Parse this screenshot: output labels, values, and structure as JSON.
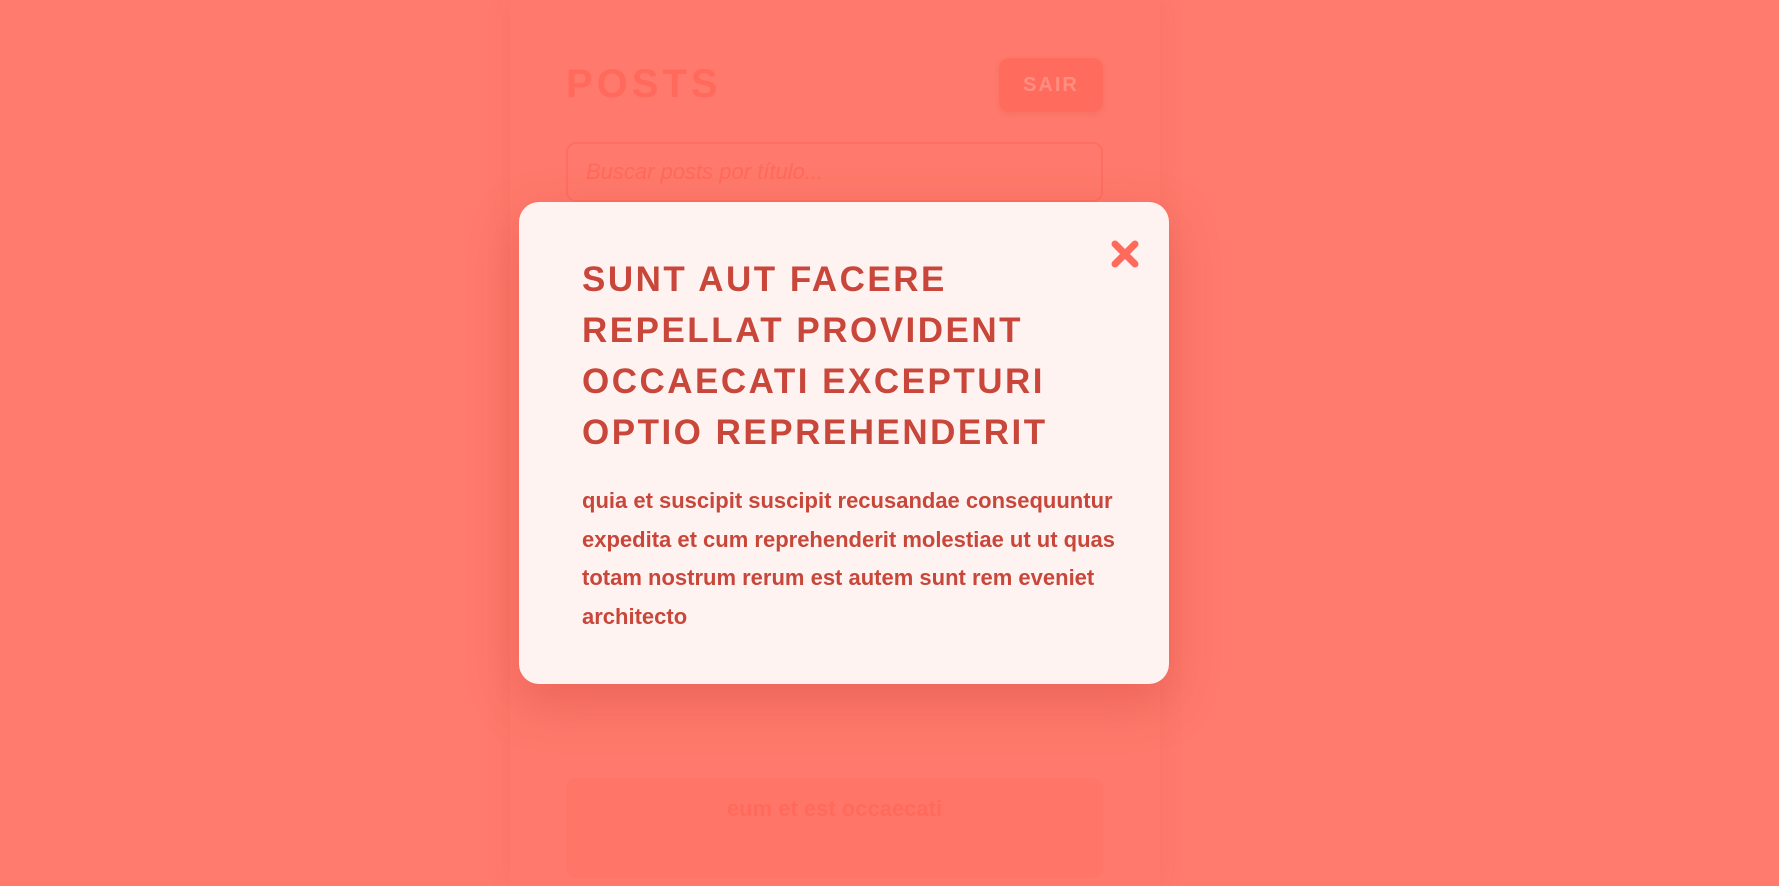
{
  "header": {
    "title": "POSTS",
    "logout_label": "SAIR"
  },
  "search": {
    "placeholder": "Buscar posts por título..."
  },
  "posts": [
    {
      "title": "eum et est occaecati"
    }
  ],
  "modal": {
    "title": "SUNT AUT FACERE REPELLAT PROVIDENT OCCAECATI EXCEPTURI OPTIO REPREHENDERIT",
    "body": "quia et suscipit suscipit recusandae consequuntur expedita et cum reprehenderit molestiae ut ut quas totam nostrum rerum est autem sunt rem eveniet architecto",
    "close_icon": "close-icon"
  },
  "colors": {
    "background": "#ff7b6d",
    "modal_background": "#fff3f1",
    "accent": "#c8473a",
    "close_icon": "#ff6a5c"
  }
}
